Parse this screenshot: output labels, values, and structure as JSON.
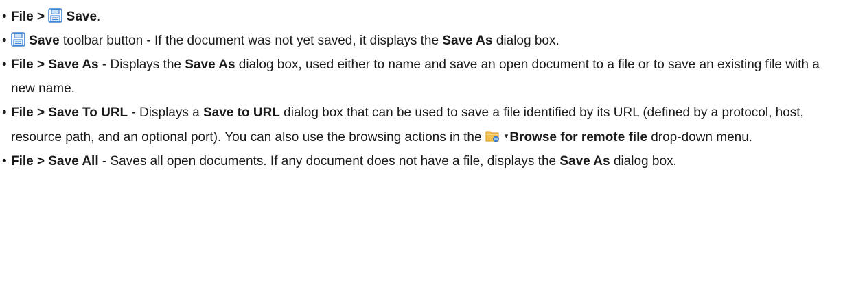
{
  "items": [
    {
      "menu": "File >",
      "command": "Save",
      "end": "."
    },
    {
      "command": "Save",
      "text_1": " toolbar button - If the document was not yet saved, it displays the ",
      "dialog": "Save As",
      "text_2": " dialog box."
    },
    {
      "menu": "File > Save As",
      "text_1": " - Displays the ",
      "dialog": "Save As",
      "text_2": " dialog box, used either to name and save an open document to a file or to save an existing file with a new name."
    },
    {
      "menu": "File > Save To URL",
      "text_1": " - Displays a ",
      "dialog": "Save to URL",
      "text_2": " dialog box that can be used to save a file identified by its URL (defined by a protocol, host, resource path, and an optional port). You can also use the browsing actions in the ",
      "caret": "▾",
      "menu_name": "Browse for remote file",
      "text_3": " drop-down menu."
    },
    {
      "menu": "File > Save All",
      "text_1": " - Saves all open documents. If any document does not have a file, displays the ",
      "dialog": "Save As",
      "text_2": " dialog box."
    }
  ],
  "bullet": "•",
  "icons": {
    "save": "floppy-disk-icon",
    "browse": "folder-remote-icon"
  },
  "colors": {
    "text": "#1a1a1a",
    "icon_blue": "#4a90d9",
    "folder_yellow": "#f0b429"
  }
}
